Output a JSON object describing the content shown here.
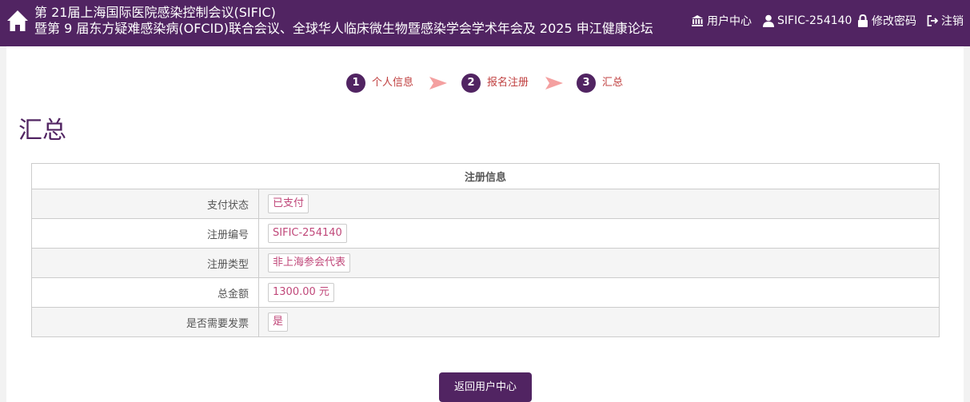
{
  "header": {
    "title_line1": "第 21届上海国际医院感染控制会议(SIFIC)",
    "title_line2": "暨第 9 届东方疑难感染病(OFCID)联合会议、全球华人临床微生物暨感染学会学术年会及 2025 申江健康论坛",
    "nav": {
      "user_center": "用户中心",
      "user_id": "SIFIC-254140",
      "change_password": "修改密码",
      "logout": "注销"
    },
    "colors": {
      "brand": "#512462"
    }
  },
  "steps": [
    {
      "num": "1",
      "label": "个人信息"
    },
    {
      "num": "2",
      "label": "报名注册"
    },
    {
      "num": "3",
      "label": "汇总"
    }
  ],
  "page_title": "汇总",
  "table": {
    "header": "注册信息",
    "rows": [
      {
        "label": "支付状态",
        "value": "已支付"
      },
      {
        "label": "注册编号",
        "value": "SIFIC-254140"
      },
      {
        "label": "注册类型",
        "value": "非上海参会代表"
      },
      {
        "label": "总金额",
        "value": "1300.00 元"
      },
      {
        "label": "是否需要发票",
        "value": "是"
      }
    ]
  },
  "back_button": "返回用户中心",
  "icons": [
    "home-icon",
    "bank-icon",
    "user-icon",
    "lock-icon",
    "logout-icon",
    "arrow-right-icon"
  ]
}
